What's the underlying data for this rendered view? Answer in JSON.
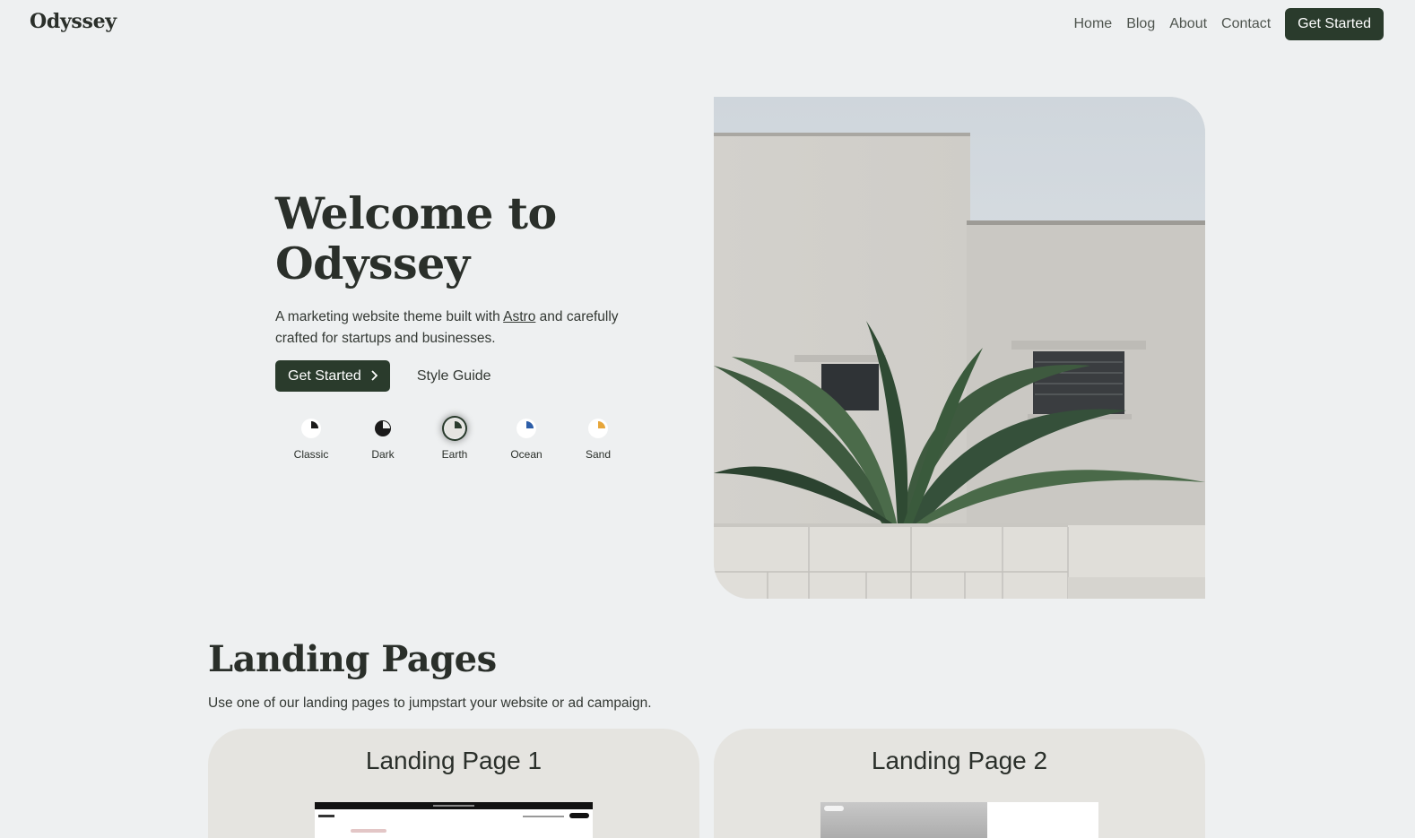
{
  "header": {
    "logo": "Odyssey",
    "nav": [
      "Home",
      "Blog",
      "About",
      "Contact"
    ],
    "cta": "Get Started"
  },
  "hero": {
    "title_line1": "Welcome to",
    "title_line2": "Odyssey",
    "subtitle_before": "A marketing website theme built with ",
    "subtitle_link": "Astro",
    "subtitle_after": " and carefully crafted for startups and businesses.",
    "primary_button": "Get Started",
    "secondary_button": "Style Guide",
    "themes": [
      {
        "label": "Classic",
        "color": "#1a1a1a",
        "bg": "#ffffff",
        "active": false
      },
      {
        "label": "Dark",
        "color": "#1a1a1a",
        "bg": "#f3f3f3",
        "active": false
      },
      {
        "label": "Earth",
        "color": "#2a3b2c",
        "bg": "#e5e4e0",
        "active": true
      },
      {
        "label": "Ocean",
        "color": "#2d5ea8",
        "bg": "#ffffff",
        "active": false
      },
      {
        "label": "Sand",
        "color": "#e7a63a",
        "bg": "#ffffff",
        "active": false
      }
    ]
  },
  "landing": {
    "title": "Landing Pages",
    "subtitle": "Use one of our landing pages to jumpstart your website or ad campaign.",
    "cards": [
      "Landing Page 1",
      "Landing Page 2"
    ]
  },
  "colors": {
    "background": "#eef0f1",
    "accent": "#2a3b2c",
    "card": "#e5e4e0"
  }
}
